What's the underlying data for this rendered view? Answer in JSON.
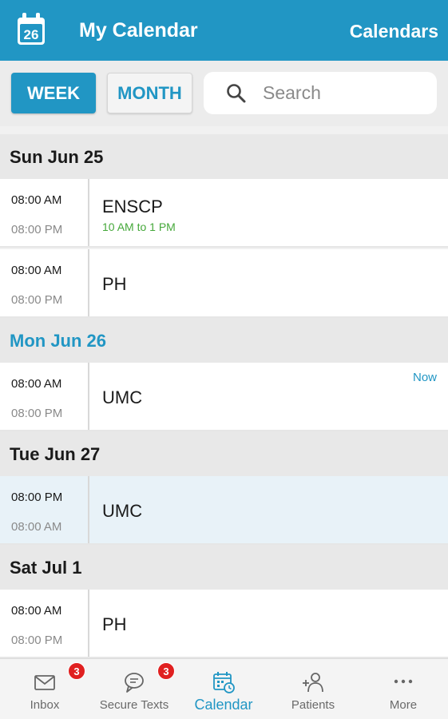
{
  "header": {
    "calendar_icon_day": "26",
    "title": "My Calendar",
    "calendars_label": "Calendars"
  },
  "view_toggle": {
    "week_label": "WEEK",
    "month_label": "MONTH",
    "selected": "WEEK"
  },
  "search": {
    "placeholder": "Search",
    "value": ""
  },
  "days": [
    {
      "label": "Sun Jun 25",
      "events": [
        {
          "start": "08:00 AM",
          "end": "08:00 PM",
          "name": "ENSCP",
          "subtitle": "10 AM to 1 PM"
        },
        {
          "start": "08:00 AM",
          "end": "08:00 PM",
          "name": "PH"
        }
      ]
    },
    {
      "label": "Mon Jun 26",
      "today": true,
      "events": [
        {
          "start": "08:00 AM",
          "end": "08:00 PM",
          "name": "UMC",
          "badge": "Now"
        }
      ]
    },
    {
      "label": "Tue Jun 27",
      "events": [
        {
          "start": "08:00 PM",
          "end": "08:00 AM",
          "name": "UMC"
        }
      ]
    },
    {
      "label": "Sat Jul 1",
      "events": [
        {
          "start": "08:00 AM",
          "end": "08:00 PM",
          "name": "PH"
        }
      ]
    }
  ],
  "tabs": [
    {
      "label": "Inbox",
      "icon": "envelope-icon",
      "badge": "3"
    },
    {
      "label": "Secure Texts",
      "icon": "chat-bubble-icon",
      "badge": "3"
    },
    {
      "label": "Calendar",
      "icon": "calendar-clock-icon",
      "active": true
    },
    {
      "label": "Patients",
      "icon": "add-person-icon"
    },
    {
      "label": "More",
      "icon": "more-dots-icon"
    }
  ],
  "colors": {
    "primary": "#2196c4",
    "badge": "#e02020",
    "subtitle_green": "#45a83a"
  }
}
